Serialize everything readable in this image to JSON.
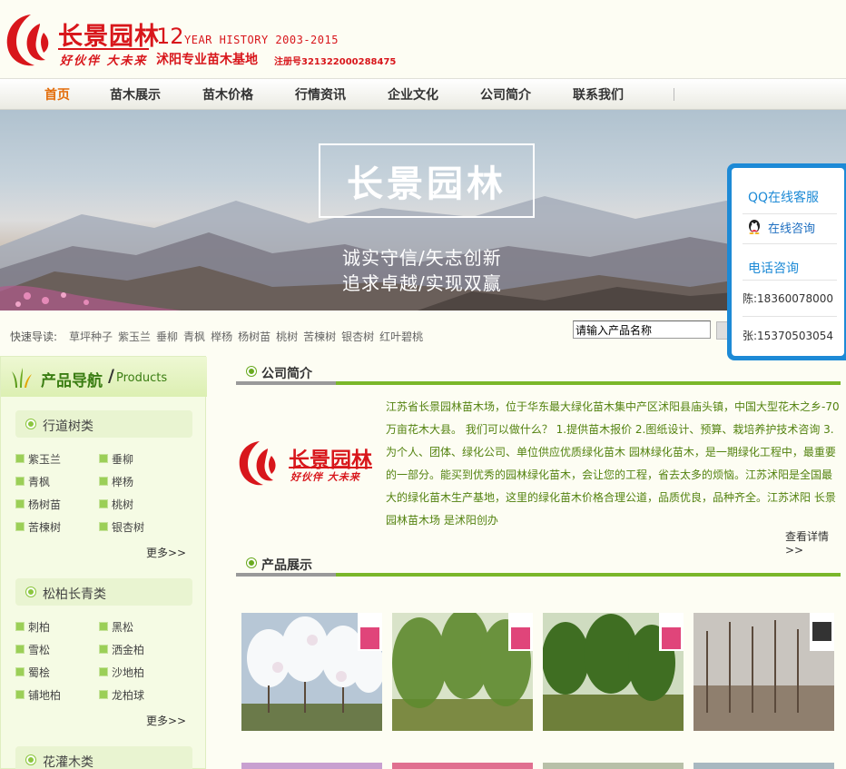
{
  "header": {
    "logo_name": "长景园林",
    "logo_slogan": "好伙伴 大未来",
    "history_num": "12",
    "history_text": "YEAR HISTORY 2003-2015",
    "base_text": "沭阳专业苗木基地",
    "reg_text": "注册号321322000288475"
  },
  "nav": {
    "items": [
      "首页",
      "苗木展示",
      "苗木价格",
      "行情资讯",
      "企业文化",
      "公司简介",
      "联系我们"
    ]
  },
  "banner": {
    "title": "长景园林",
    "line1": "诚实守信/矢志创新",
    "line2": "追求卓越/实现双赢"
  },
  "quick": {
    "label": "快速导读:",
    "links": [
      "草坪种子",
      "紫玉兰",
      "垂柳",
      "青枫",
      "榉杨",
      "杨树苗",
      "桃树",
      "苦楝树",
      "银杏树",
      "红叶碧桃"
    ],
    "search_value": "请输入产品名称"
  },
  "qq": {
    "title": "QQ在线客服",
    "consult": "在线咨询",
    "phone_title": "电话咨询",
    "phone1": "陈:18360078000",
    "phone2": "张:15370503054"
  },
  "sidebar": {
    "header_cn": "产品导航",
    "header_slash": "/",
    "header_en": "Products",
    "categories": [
      {
        "title": "行道树类",
        "items": [
          "紫玉兰",
          "垂柳",
          "青枫",
          "榉杨",
          "杨树苗",
          "桃树",
          "苦楝树",
          "银杏树"
        ],
        "more": "更多>>"
      },
      {
        "title": "松柏长青类",
        "items": [
          "刺柏",
          "黑松",
          "雪松",
          "洒金柏",
          "蜀桧",
          "沙地柏",
          "铺地柏",
          "龙柏球"
        ],
        "more": "更多>>"
      },
      {
        "title": "花灌木类",
        "items": [],
        "more": ""
      }
    ]
  },
  "main": {
    "intro_title": "公司简介",
    "intro_text": "江苏省长景园林苗木场，位于华东最大绿化苗木集中产区沭阳县庙头镇，中国大型花木之乡-70万亩花木大县。 我们可以做什么？ 1.提供苗木报价 2.图纸设计、预算、栽培养护技术咨询 3.为个人、团体、绿化公司、单位供应优质绿化苗木 园林绿化苗木，是一期绿化工程中，最重要的一部分。能买到优秀的园林绿化苗木，会让您的工程，省去太多的烦恼。江苏沭阳是全国最大的绿化苗木生产基地，这里的绿化苗木价格合理公道，品质优良，品种齐全。江苏沭阳 长景园林苗木场 是沭阳创办",
    "detail_link": "查看详情>>",
    "products_title": "产品展示"
  },
  "colors": {
    "brand_red": "#d8161b",
    "green": "#7ab72a",
    "qq_blue": "#1d8ad6"
  }
}
